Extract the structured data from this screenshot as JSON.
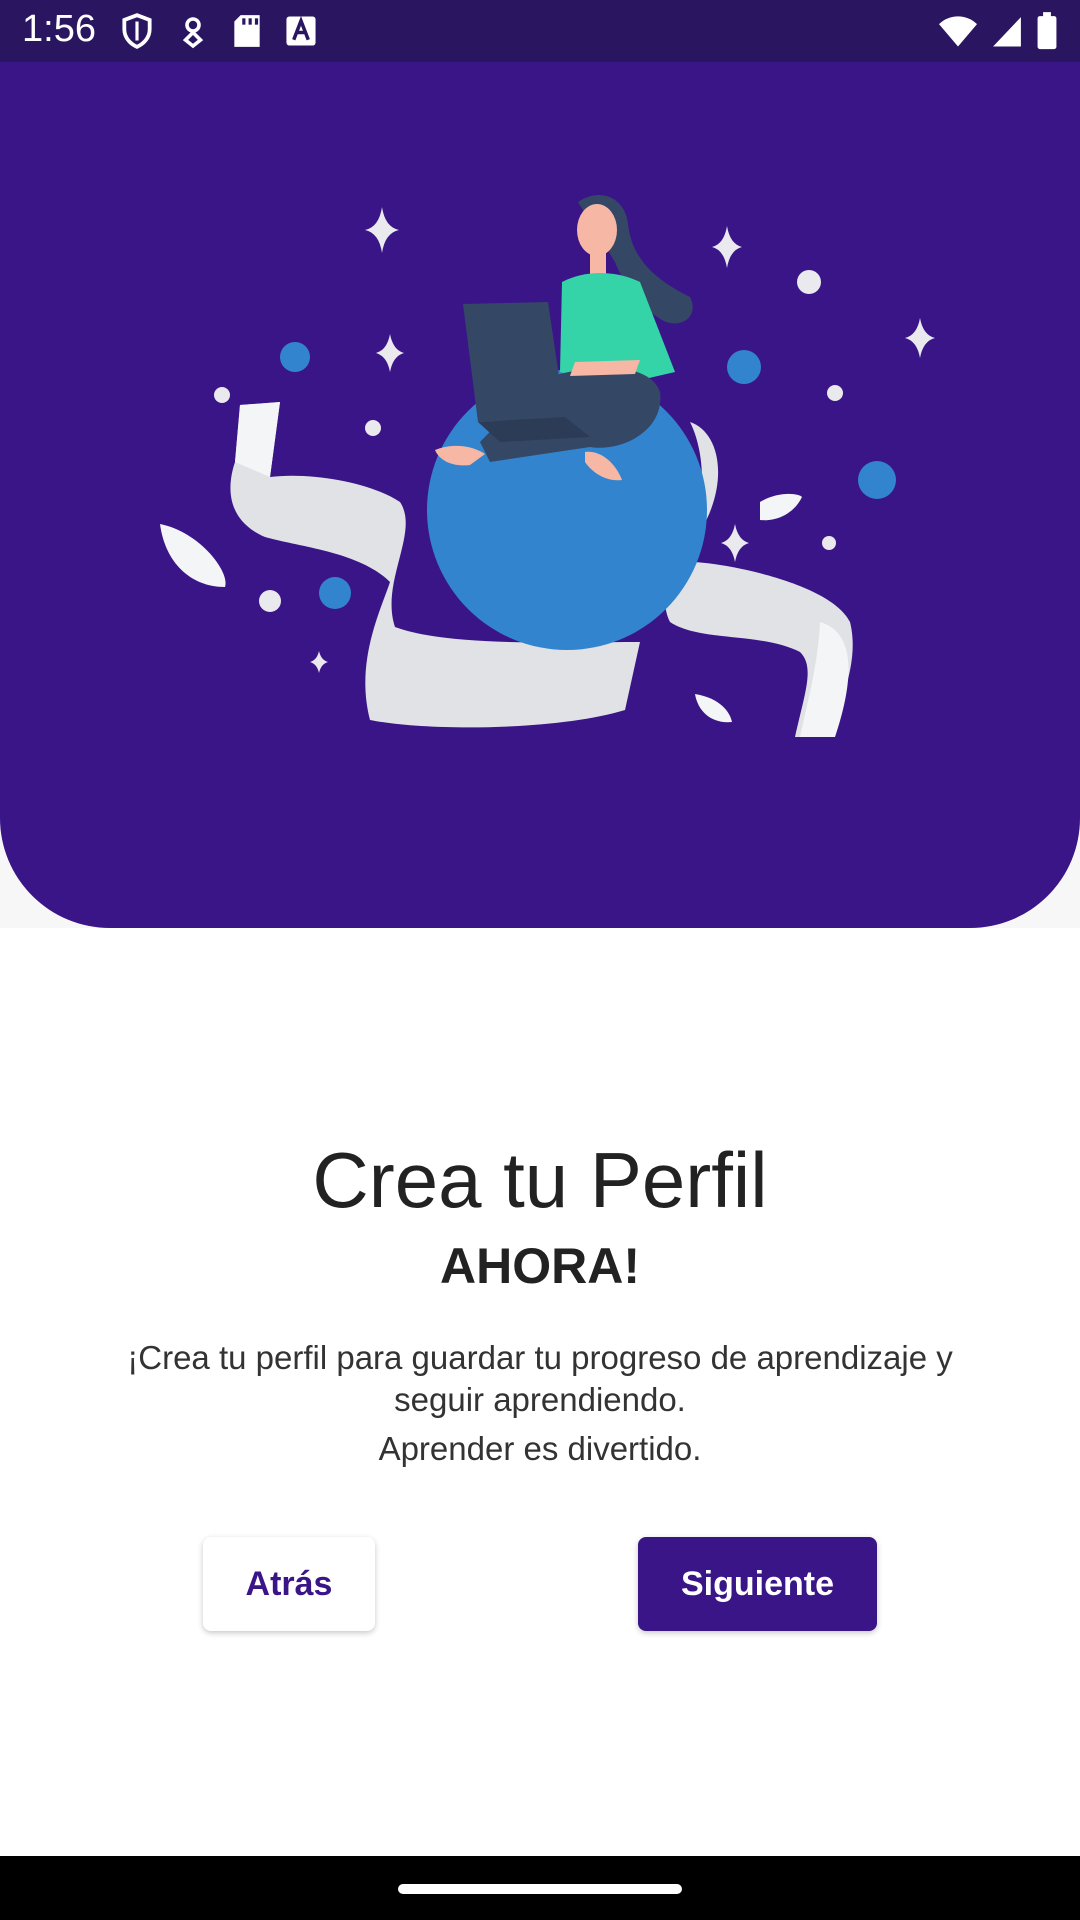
{
  "status_bar": {
    "time": "1:56",
    "left_icons": [
      "shield-icon",
      "location-pin-icon",
      "sd-card-icon",
      "font-a-icon"
    ],
    "right_icons": [
      "wifi-icon",
      "cell-signal-icon",
      "battery-icon"
    ]
  },
  "hero": {
    "illustration": "woman-with-laptop-on-globe-illustration",
    "background_color": "#3a1588"
  },
  "onboarding": {
    "title": "Crea tu Perfil",
    "subtitle": "AHORA!",
    "description": "¡Crea tu perfil para guardar tu progreso de aprendizaje y seguir aprendiendo.",
    "description_2": "Aprender es divertido."
  },
  "buttons": {
    "back_label": "Atrás",
    "next_label": "Siguiente"
  },
  "colors": {
    "primary": "#3a1588",
    "status_bar": "#2a1560"
  }
}
